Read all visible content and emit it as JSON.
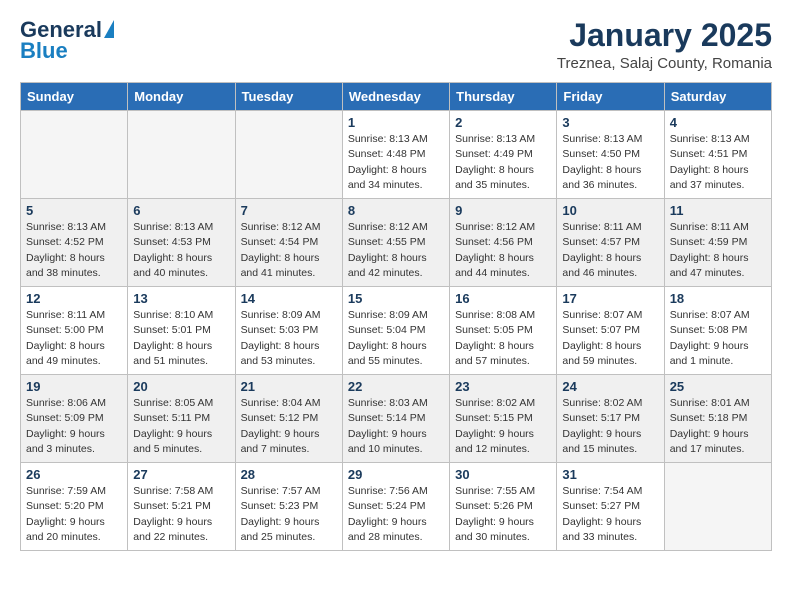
{
  "header": {
    "logo_general": "General",
    "logo_blue": "Blue",
    "month_title": "January 2025",
    "location": "Treznea, Salaj County, Romania"
  },
  "weekdays": [
    "Sunday",
    "Monday",
    "Tuesday",
    "Wednesday",
    "Thursday",
    "Friday",
    "Saturday"
  ],
  "weeks": [
    [
      {
        "day": "",
        "info": ""
      },
      {
        "day": "",
        "info": ""
      },
      {
        "day": "",
        "info": ""
      },
      {
        "day": "1",
        "info": "Sunrise: 8:13 AM\nSunset: 4:48 PM\nDaylight: 8 hours\nand 34 minutes."
      },
      {
        "day": "2",
        "info": "Sunrise: 8:13 AM\nSunset: 4:49 PM\nDaylight: 8 hours\nand 35 minutes."
      },
      {
        "day": "3",
        "info": "Sunrise: 8:13 AM\nSunset: 4:50 PM\nDaylight: 8 hours\nand 36 minutes."
      },
      {
        "day": "4",
        "info": "Sunrise: 8:13 AM\nSunset: 4:51 PM\nDaylight: 8 hours\nand 37 minutes."
      }
    ],
    [
      {
        "day": "5",
        "info": "Sunrise: 8:13 AM\nSunset: 4:52 PM\nDaylight: 8 hours\nand 38 minutes."
      },
      {
        "day": "6",
        "info": "Sunrise: 8:13 AM\nSunset: 4:53 PM\nDaylight: 8 hours\nand 40 minutes."
      },
      {
        "day": "7",
        "info": "Sunrise: 8:12 AM\nSunset: 4:54 PM\nDaylight: 8 hours\nand 41 minutes."
      },
      {
        "day": "8",
        "info": "Sunrise: 8:12 AM\nSunset: 4:55 PM\nDaylight: 8 hours\nand 42 minutes."
      },
      {
        "day": "9",
        "info": "Sunrise: 8:12 AM\nSunset: 4:56 PM\nDaylight: 8 hours\nand 44 minutes."
      },
      {
        "day": "10",
        "info": "Sunrise: 8:11 AM\nSunset: 4:57 PM\nDaylight: 8 hours\nand 46 minutes."
      },
      {
        "day": "11",
        "info": "Sunrise: 8:11 AM\nSunset: 4:59 PM\nDaylight: 8 hours\nand 47 minutes."
      }
    ],
    [
      {
        "day": "12",
        "info": "Sunrise: 8:11 AM\nSunset: 5:00 PM\nDaylight: 8 hours\nand 49 minutes."
      },
      {
        "day": "13",
        "info": "Sunrise: 8:10 AM\nSunset: 5:01 PM\nDaylight: 8 hours\nand 51 minutes."
      },
      {
        "day": "14",
        "info": "Sunrise: 8:09 AM\nSunset: 5:03 PM\nDaylight: 8 hours\nand 53 minutes."
      },
      {
        "day": "15",
        "info": "Sunrise: 8:09 AM\nSunset: 5:04 PM\nDaylight: 8 hours\nand 55 minutes."
      },
      {
        "day": "16",
        "info": "Sunrise: 8:08 AM\nSunset: 5:05 PM\nDaylight: 8 hours\nand 57 minutes."
      },
      {
        "day": "17",
        "info": "Sunrise: 8:07 AM\nSunset: 5:07 PM\nDaylight: 8 hours\nand 59 minutes."
      },
      {
        "day": "18",
        "info": "Sunrise: 8:07 AM\nSunset: 5:08 PM\nDaylight: 9 hours\nand 1 minute."
      }
    ],
    [
      {
        "day": "19",
        "info": "Sunrise: 8:06 AM\nSunset: 5:09 PM\nDaylight: 9 hours\nand 3 minutes."
      },
      {
        "day": "20",
        "info": "Sunrise: 8:05 AM\nSunset: 5:11 PM\nDaylight: 9 hours\nand 5 minutes."
      },
      {
        "day": "21",
        "info": "Sunrise: 8:04 AM\nSunset: 5:12 PM\nDaylight: 9 hours\nand 7 minutes."
      },
      {
        "day": "22",
        "info": "Sunrise: 8:03 AM\nSunset: 5:14 PM\nDaylight: 9 hours\nand 10 minutes."
      },
      {
        "day": "23",
        "info": "Sunrise: 8:02 AM\nSunset: 5:15 PM\nDaylight: 9 hours\nand 12 minutes."
      },
      {
        "day": "24",
        "info": "Sunrise: 8:02 AM\nSunset: 5:17 PM\nDaylight: 9 hours\nand 15 minutes."
      },
      {
        "day": "25",
        "info": "Sunrise: 8:01 AM\nSunset: 5:18 PM\nDaylight: 9 hours\nand 17 minutes."
      }
    ],
    [
      {
        "day": "26",
        "info": "Sunrise: 7:59 AM\nSunset: 5:20 PM\nDaylight: 9 hours\nand 20 minutes."
      },
      {
        "day": "27",
        "info": "Sunrise: 7:58 AM\nSunset: 5:21 PM\nDaylight: 9 hours\nand 22 minutes."
      },
      {
        "day": "28",
        "info": "Sunrise: 7:57 AM\nSunset: 5:23 PM\nDaylight: 9 hours\nand 25 minutes."
      },
      {
        "day": "29",
        "info": "Sunrise: 7:56 AM\nSunset: 5:24 PM\nDaylight: 9 hours\nand 28 minutes."
      },
      {
        "day": "30",
        "info": "Sunrise: 7:55 AM\nSunset: 5:26 PM\nDaylight: 9 hours\nand 30 minutes."
      },
      {
        "day": "31",
        "info": "Sunrise: 7:54 AM\nSunset: 5:27 PM\nDaylight: 9 hours\nand 33 minutes."
      },
      {
        "day": "",
        "info": ""
      }
    ]
  ]
}
